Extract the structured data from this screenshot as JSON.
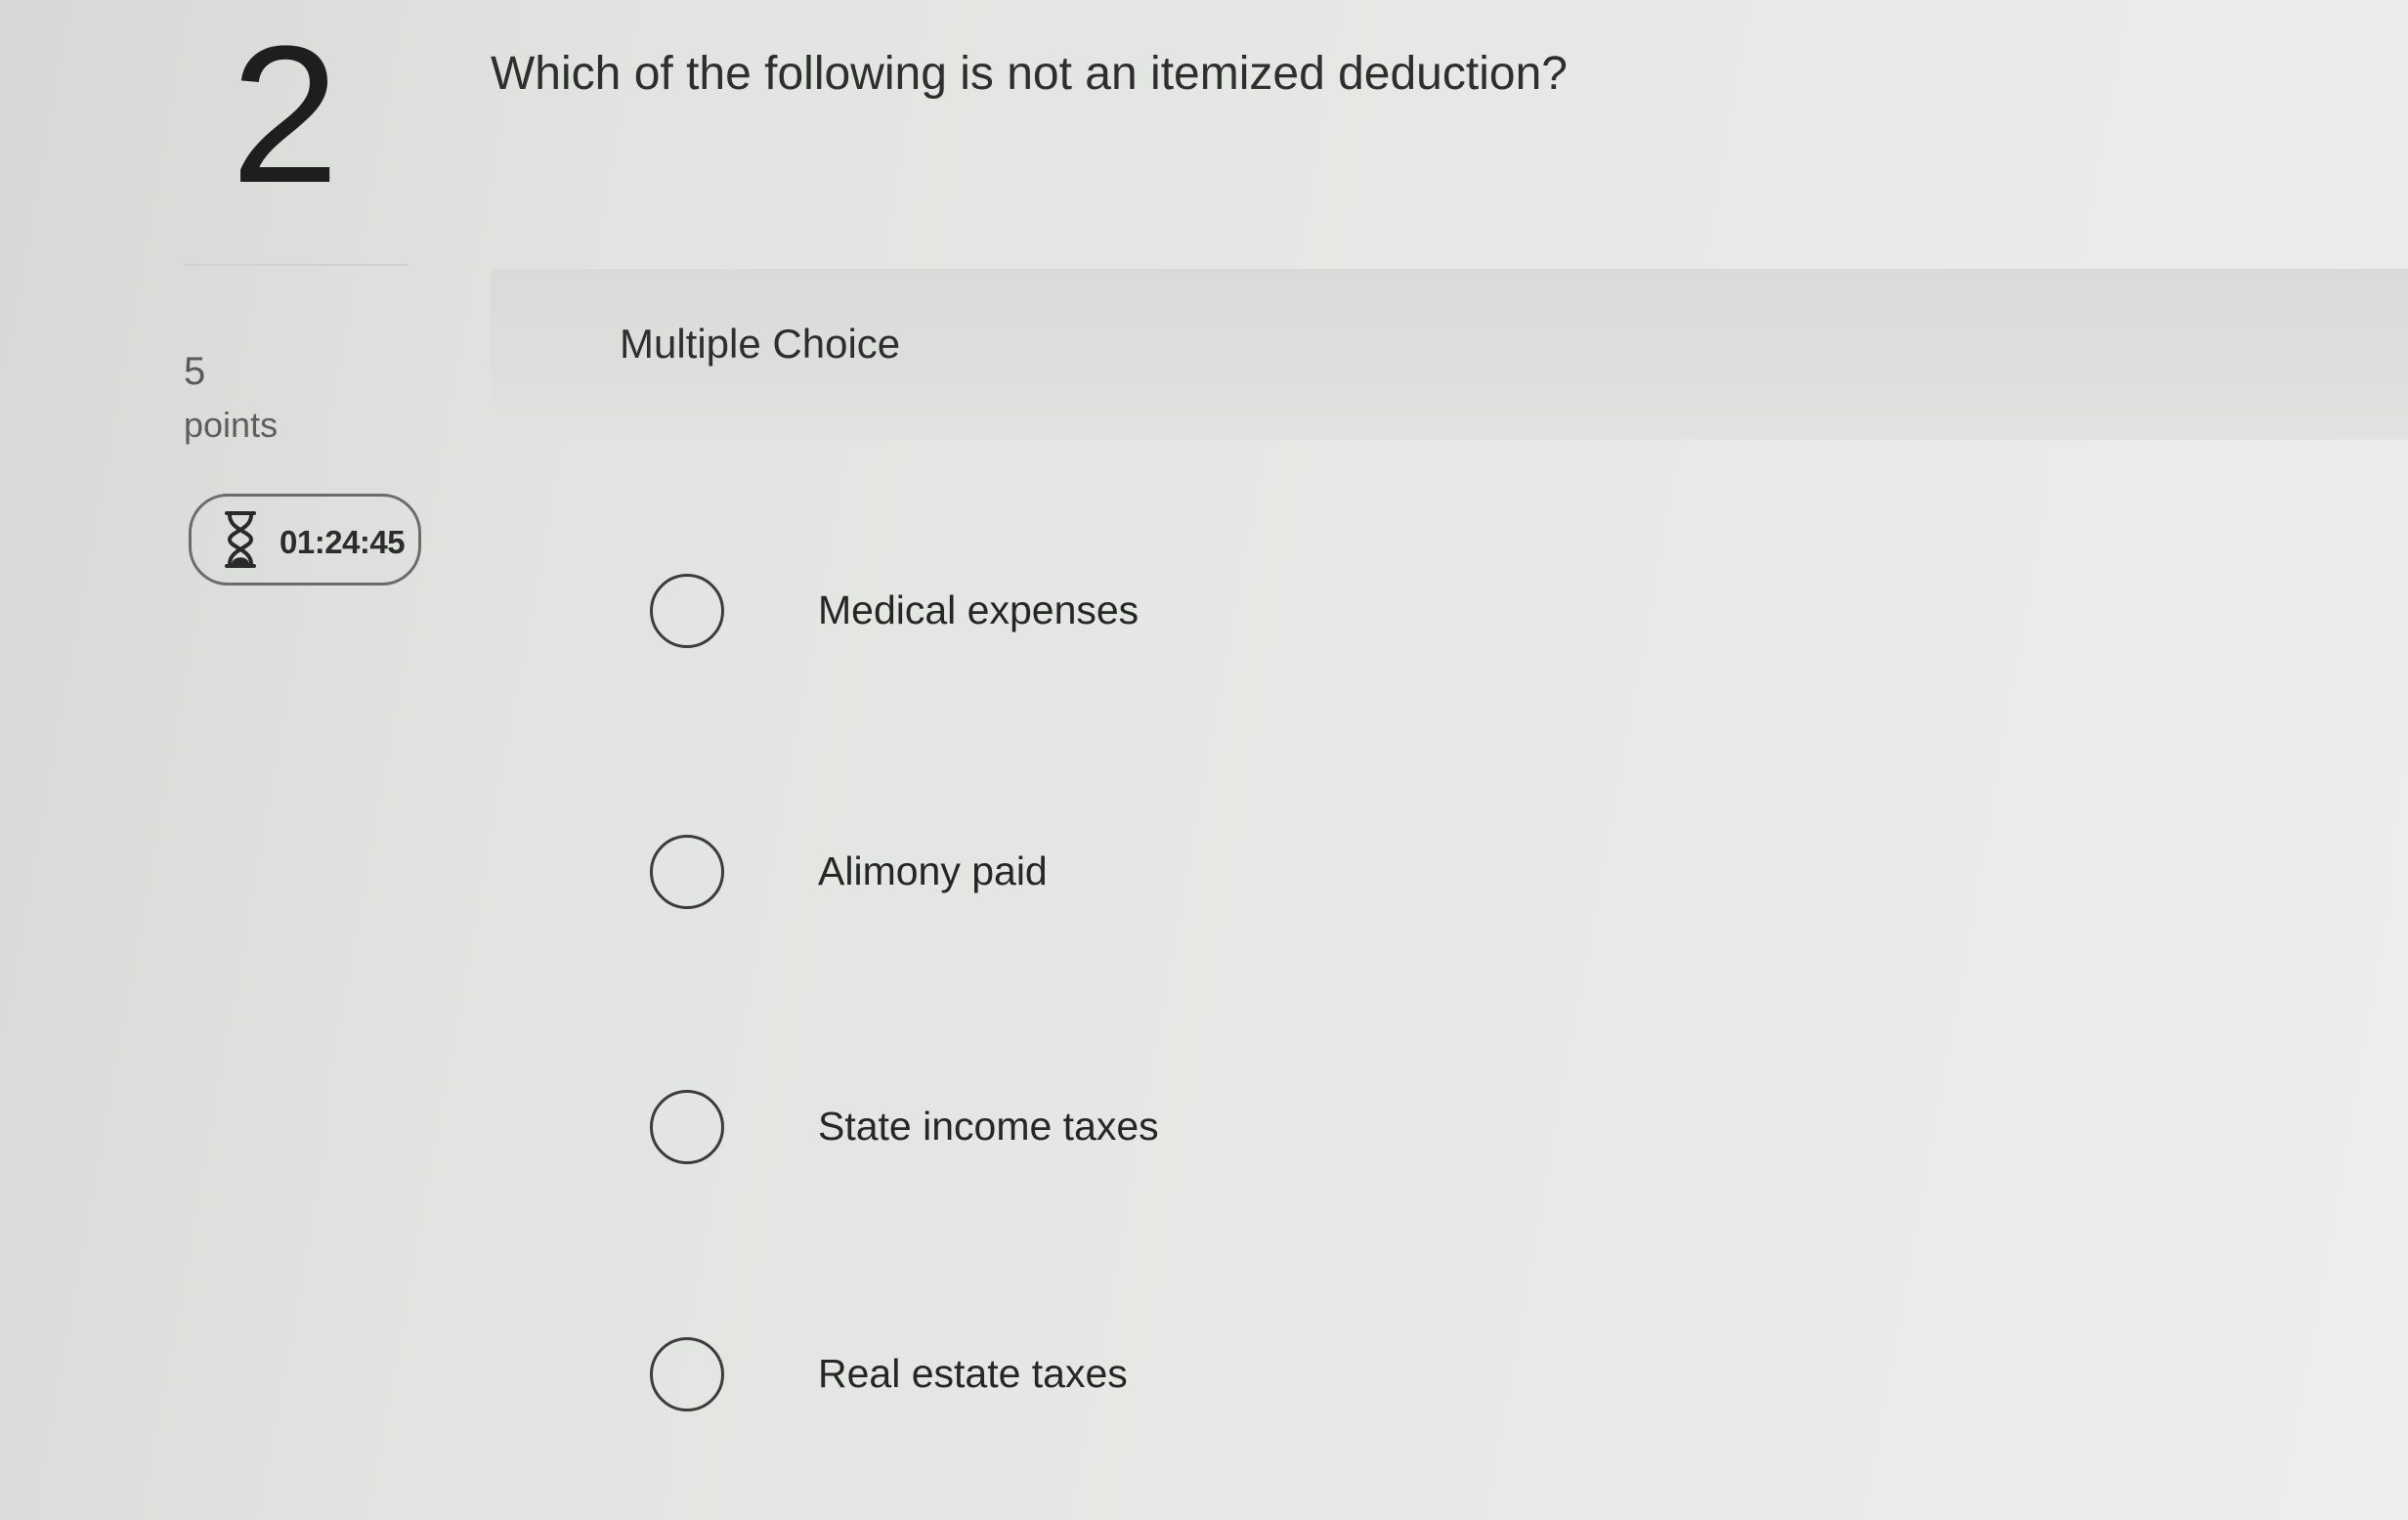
{
  "question": {
    "number": "2",
    "points_value": "5",
    "points_label": "points",
    "timer": "01:24:45",
    "timer_icon": "hourglass-icon",
    "text": "Which of the following is not an itemized deduction?",
    "type": "Multiple Choice"
  },
  "options": [
    {
      "label": "Medical expenses",
      "selected": false
    },
    {
      "label": "Alimony paid",
      "selected": false
    },
    {
      "label": "State income taxes",
      "selected": false
    },
    {
      "label": "Real estate taxes",
      "selected": false
    }
  ]
}
